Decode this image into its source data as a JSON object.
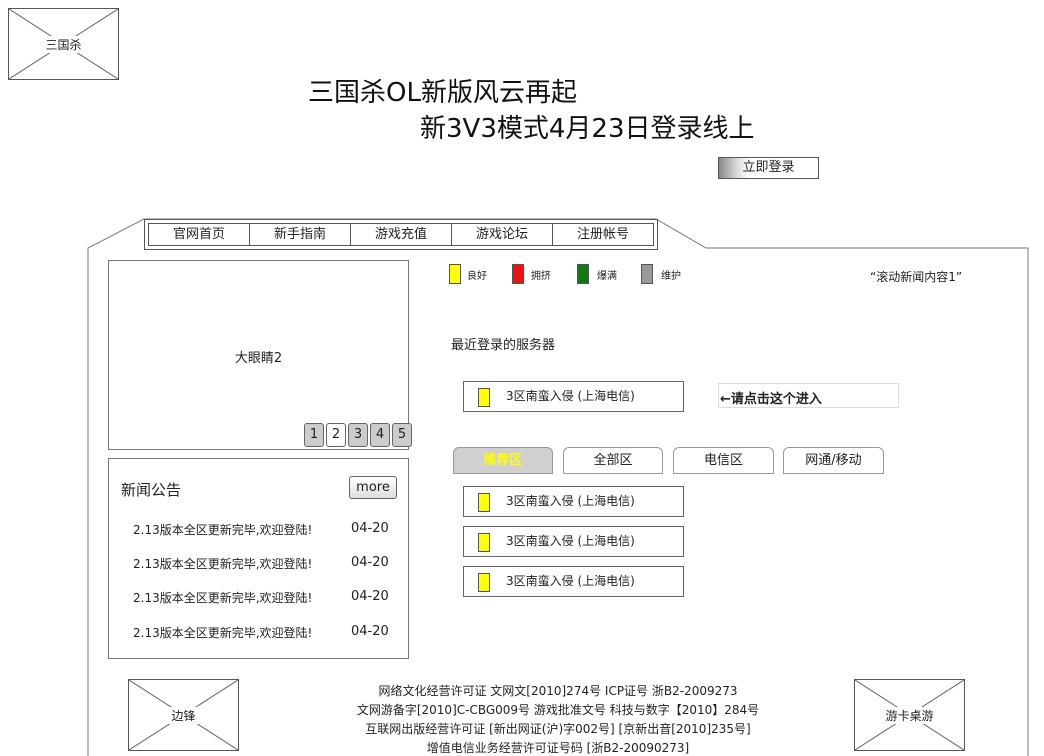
{
  "logo": {
    "label": "三国杀"
  },
  "headline": {
    "line1": "三国杀OL新版风云再起",
    "line2": "新3V3模式4月23日登录线上"
  },
  "login_button": "立即登录",
  "nav": {
    "items": [
      "官网首页",
      "新手指南",
      "游戏充值",
      "游戏论坛",
      "注册帐号"
    ]
  },
  "carousel": {
    "label": "大眼睛2",
    "pages": [
      "1",
      "2",
      "3",
      "4",
      "5"
    ],
    "active_page": "2"
  },
  "news": {
    "title": "新闻公告",
    "more": "more",
    "items": [
      {
        "text": "2.13版本全区更新完毕,欢迎登陆!",
        "date": "04-20"
      },
      {
        "text": "2.13版本全区更新完毕,欢迎登陆!",
        "date": "04-20"
      },
      {
        "text": "2.13版本全区更新完毕,欢迎登陆!",
        "date": "04-20"
      },
      {
        "text": "2.13版本全区更新完毕,欢迎登陆!",
        "date": "04-20"
      }
    ]
  },
  "status_legend": [
    {
      "label": "良好",
      "color": "#ffff00"
    },
    {
      "label": "拥挤",
      "color": "#ee1111"
    },
    {
      "label": "爆满",
      "color": "#117711"
    },
    {
      "label": "维护",
      "color": "#999999"
    }
  ],
  "ticker": "“滚动新闻内容1”",
  "recent": {
    "title": "最近登录的服务器",
    "server": "3区南蛮入侵 (上海电信)",
    "hint": "←请点击这个进入"
  },
  "server_tabs": [
    "推荐区",
    "全部区",
    "电信区",
    "网通/移动"
  ],
  "server_list": [
    "3区南蛮入侵 (上海电信)",
    "3区南蛮入侵 (上海电信)",
    "3区南蛮入侵 (上海电信)"
  ],
  "footer": {
    "left_logo": "边锋",
    "right_logo": "游卡桌游",
    "lines": [
      "网络文化经营许可证 文网文[2010]274号 ICP证号 浙B2-2009273",
      "文网游备字[2010]C-CBG009号  游戏批准文号 科技与数字【2010】284号",
      "互联网出版经营许可证 [新出网证(沪)字002号] [京新出音[2010]235号]",
      "增值电信业务经营许可证号码    [浙B2-20090273]"
    ]
  }
}
